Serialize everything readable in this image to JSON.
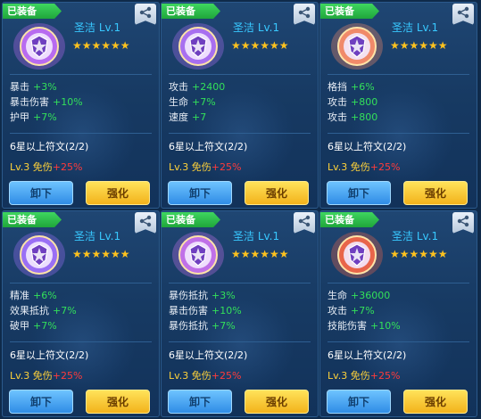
{
  "cards": [
    {
      "badge": "已装备",
      "title": "圣洁 Lv.1",
      "stars": "★★★★★★",
      "stats": [
        {
          "name": "暴击",
          "value": "+3%"
        },
        {
          "name": "暴击伤害",
          "value": "+10%"
        },
        {
          "name": "护甲",
          "value": "+7%"
        }
      ],
      "set_bonus": "6星以上符文(2/2)",
      "level_prefix": "Lv.3 免伤",
      "level_value": "+25%",
      "unequip_label": "卸下",
      "upgrade_label": "强化",
      "emblem_color": "#b86bf0"
    },
    {
      "badge": "已装备",
      "title": "圣洁 Lv.1",
      "stars": "★★★★★★",
      "stats": [
        {
          "name": "攻击",
          "value": "+2400"
        },
        {
          "name": "生命",
          "value": "+7%"
        },
        {
          "name": "速度",
          "value": "+7"
        }
      ],
      "set_bonus": "6星以上符文(2/2)",
      "level_prefix": "Lv.3 免伤",
      "level_value": "+25%",
      "unequip_label": "卸下",
      "upgrade_label": "强化",
      "emblem_color": "#a86ff0"
    },
    {
      "badge": "已装备",
      "title": "圣洁 Lv.1",
      "stars": "★★★★★★",
      "stats": [
        {
          "name": "格挡",
          "value": "+6%"
        },
        {
          "name": "攻击",
          "value": "+800"
        },
        {
          "name": "攻击",
          "value": "+800"
        }
      ],
      "set_bonus": "6星以上符文(2/2)",
      "level_prefix": "Lv.3 免伤",
      "level_value": "+25%",
      "unequip_label": "卸下",
      "upgrade_label": "强化",
      "emblem_color": "#f08a6a"
    },
    {
      "badge": "已装备",
      "title": "圣洁 Lv.1",
      "stars": "★★★★★★",
      "stats": [
        {
          "name": "精准",
          "value": "+6%"
        },
        {
          "name": "效果抵抗",
          "value": "+7%"
        },
        {
          "name": "破甲",
          "value": "+7%"
        }
      ],
      "set_bonus": "6星以上符文(2/2)",
      "level_prefix": "Lv.3 免伤",
      "level_value": "+25%",
      "unequip_label": "卸下",
      "upgrade_label": "强化",
      "emblem_color": "#9a6ff5"
    },
    {
      "badge": "已装备",
      "title": "圣洁 Lv.1",
      "stars": "★★★★★★",
      "stats": [
        {
          "name": "暴伤抵抗",
          "value": "+3%"
        },
        {
          "name": "暴击伤害",
          "value": "+10%"
        },
        {
          "name": "暴伤抵抗",
          "value": "+7%"
        }
      ],
      "set_bonus": "6星以上符文(2/2)",
      "level_prefix": "Lv.3 免伤",
      "level_value": "+25%",
      "unequip_label": "卸下",
      "upgrade_label": "强化",
      "emblem_color": "#c070e8"
    },
    {
      "badge": "已装备",
      "title": "圣洁 Lv.1",
      "stars": "★★★★★★",
      "stats": [
        {
          "name": "生命",
          "value": "+36000"
        },
        {
          "name": "攻击",
          "value": "+7%"
        },
        {
          "name": "技能伤害",
          "value": "+10%"
        }
      ],
      "set_bonus": "6星以上符文(2/2)",
      "level_prefix": "Lv.3 免伤",
      "level_value": "+25%",
      "unequip_label": "卸下",
      "upgrade_label": "强化",
      "emblem_color": "#e8654a"
    }
  ]
}
